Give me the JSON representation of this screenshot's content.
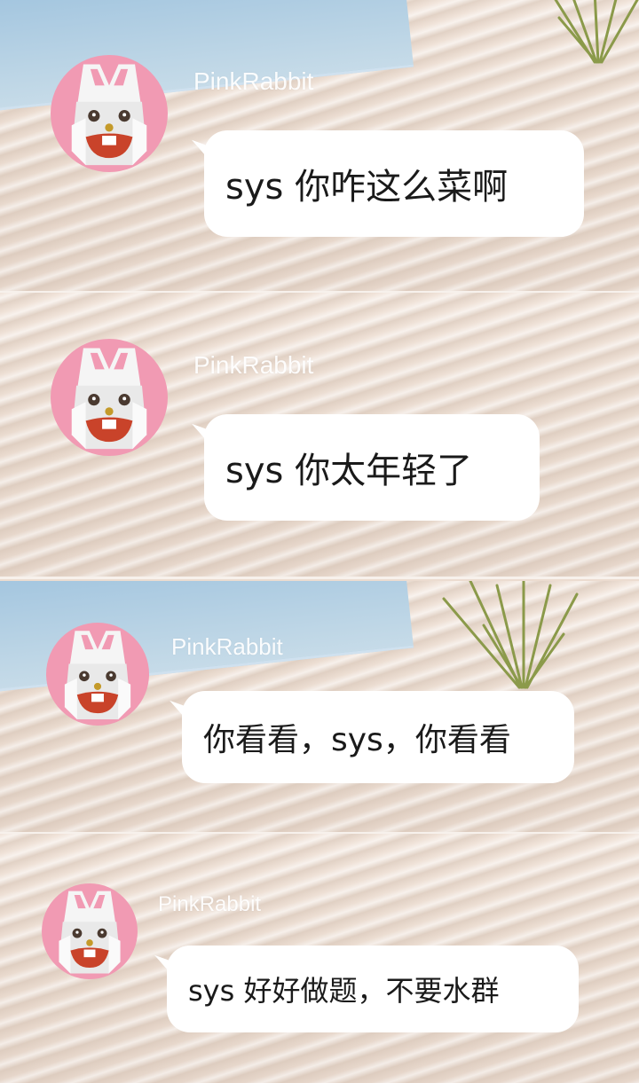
{
  "messages": [
    {
      "username": "PinkRabbit",
      "text": "sys 你咋这么菜啊"
    },
    {
      "username": "PinkRabbit",
      "text": "sys 你太年轻了"
    },
    {
      "username": "PinkRabbit",
      "text": "你看看，sys，你看看"
    },
    {
      "username": "PinkRabbit",
      "text": "sys 好好做题，不要水群"
    }
  ],
  "avatar_icon": "rabbit-avatar-icon",
  "colors": {
    "avatar_bg": "#f19ab3",
    "bubble_bg": "#ffffff",
    "username": "#ffffff"
  }
}
